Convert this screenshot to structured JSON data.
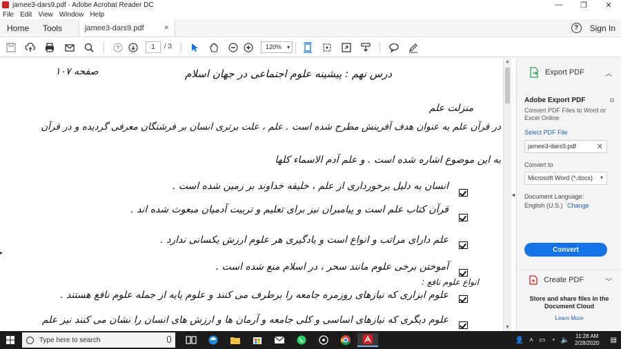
{
  "window": {
    "title": "jamee3-dars9.pdf - Adobe Acrobat Reader DC",
    "minimize": "—",
    "maximize": "❐",
    "close": "✕"
  },
  "menu": [
    "File",
    "Edit",
    "View",
    "Window",
    "Help"
  ],
  "nav": {
    "home": "Home",
    "tools": "Tools",
    "doc_tab": "jamee3-dars9.pdf",
    "doc_tab_close": "✕",
    "help": "?",
    "sign_in": "Sign In"
  },
  "toolbar": {
    "page_current": "1",
    "page_total": "/ 3",
    "zoom": "120%",
    "icons": [
      "save-icon",
      "upload-icon",
      "print-icon",
      "email-icon",
      "search-icon",
      "page-up-icon",
      "page-down-icon",
      "select-cursor-icon",
      "hand-icon",
      "zoom-out-icon",
      "zoom-in-icon",
      "fit-page-icon",
      "read-mode-icon",
      "fullscreen-icon",
      "scroll-mode-icon",
      "comment-icon",
      "pen-icon"
    ]
  },
  "document": {
    "lines": [
      "درس نهم : پیشینه علوم اجتماعی در جهان اسلام",
      "صفحه ۱۰۷",
      "منزلت علم",
      "در قرآن علم به عنوان هدف آفرینش مطرح شده است . علم ، علت برتری انسان بر فرشتگان معرفی گردیده و در قرآن",
      "به این موضوع اشاره شده است . و علم آدم الاسماء کلها",
      "انسان به دلیل برخورداری از علم ، خلیفه خداوند بر زمین شده است .",
      "قرآن کتاب علم است و پیامبران نیز برای تعلیم و تربیت آدمیان مبعوث شده اند .",
      "علم دارای مراتب و انواع است و یادگیری هر علوم ارزش یکسانی ندارد .",
      "آموختن برخی علوم مانند سحر ، در اسلام منع شده است .",
      "انواع علوم نافع :",
      "علوم ابزاری که نیازهای روزمره جامعه را برطرف می کنند و علوم پایه از جمله علوم نافع هستند .",
      "علوم دیگری که نیازهای اساسی و کلی جامعه و آرمان ها و ارزش های انسان را نشان می کنند نیز علم"
    ]
  },
  "panel": {
    "export_title": "Export PDF",
    "adobe_export": "Adobe Export PDF",
    "description": "Convert PDF Files to Word or Excel Online",
    "select_file": "Select PDF File",
    "file_name": "jamee3-dars9.pdf",
    "convert_to_label": "Convert to",
    "convert_to_value": "Microsoft Word (*.docx)",
    "language_label": "Document Language:",
    "language_value": "English (U.S.)",
    "change": "Change",
    "convert_button": "Convert",
    "create_pdf": "Create PDF",
    "store_text": "Store and share files in the Document Cloud",
    "learn_more": "Learn More"
  },
  "taskbar": {
    "search_placeholder": "Type here to search",
    "time": "11:28 AM",
    "date": "2/28/2020",
    "apps": [
      "task-view-icon",
      "edge-icon",
      "file-explorer-icon",
      "store-icon",
      "mail-icon",
      "whatsapp-icon",
      "media-icon",
      "chrome-icon",
      "acrobat-icon"
    ]
  },
  "colors": {
    "accent": "#1473e6",
    "link": "#1a5fb4",
    "acrobat_red": "#d71f1f",
    "taskbar": "#1c1c1c"
  }
}
